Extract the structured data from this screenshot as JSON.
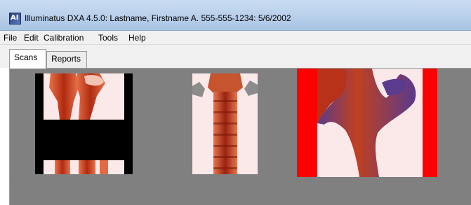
{
  "window": {
    "title": "Illuminatus DXA 4.5.0: Lastname, Firstname A. 555-555-1234: 5/6/2002",
    "icon": "app-icon"
  },
  "menu": {
    "items": [
      "File",
      "Edit",
      "Calibration",
      "Tools",
      "Help"
    ]
  },
  "tabs": [
    {
      "label": "Scans",
      "selected": true
    },
    {
      "label": "Reports",
      "selected": false
    }
  ],
  "scans": [
    {
      "name": "forearm-scan-thumbnail",
      "selected": false
    },
    {
      "name": "spine-scan-thumbnail",
      "selected": false
    },
    {
      "name": "hip-scan-thumbnail",
      "selected": true
    }
  ],
  "colors": {
    "grid_bg": "#808080",
    "selected_bg": "#ff0000",
    "bone": "#c03a10",
    "tissue": "#fbe9ea",
    "mask": "#000000"
  }
}
